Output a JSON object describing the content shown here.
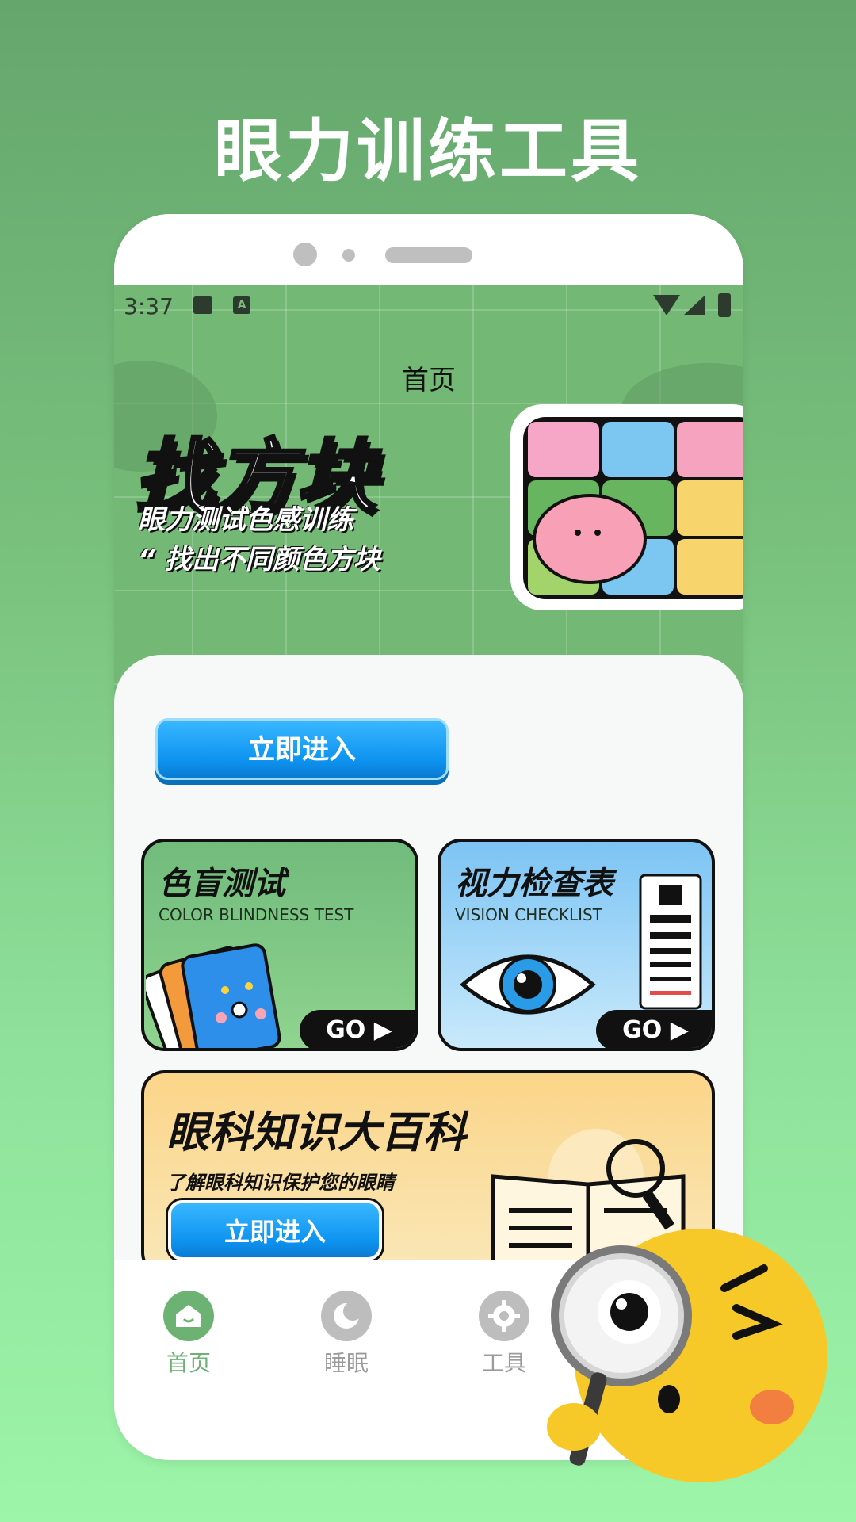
{
  "promo": {
    "title": "眼力训练工具"
  },
  "status_bar": {
    "time": "3:37"
  },
  "header": {
    "title": "首页"
  },
  "hero": {
    "logo_text": "找方块",
    "subtitle_1": "眼力测试色感训练",
    "subtitle_2": "“ 找出不同颜色方块"
  },
  "main": {
    "enter_button": "立即进入",
    "cards": {
      "color_blind": {
        "title": "色盲测试",
        "subtitle": "COLOR BLINDNESS TEST",
        "go_label": "GO ▶"
      },
      "vision_chart": {
        "title": "视力检查表",
        "subtitle": "VISION CHECKLIST",
        "go_label": "GO ▶"
      }
    },
    "encyclopedia": {
      "title": "眼科知识大百科",
      "subtitle": "了解眼科知识保护您的眼睛",
      "button": "立即进入"
    }
  },
  "tabbar": {
    "items": [
      {
        "label": "首页",
        "icon": "home-icon",
        "active": true
      },
      {
        "label": "睡眠",
        "icon": "moon-icon",
        "active": false
      },
      {
        "label": "工具",
        "icon": "gear-icon",
        "active": false
      }
    ]
  },
  "colors": {
    "accent_green": "#6cb373",
    "button_blue": "#0d93f0",
    "inactive_gray": "#bdbdbd"
  }
}
